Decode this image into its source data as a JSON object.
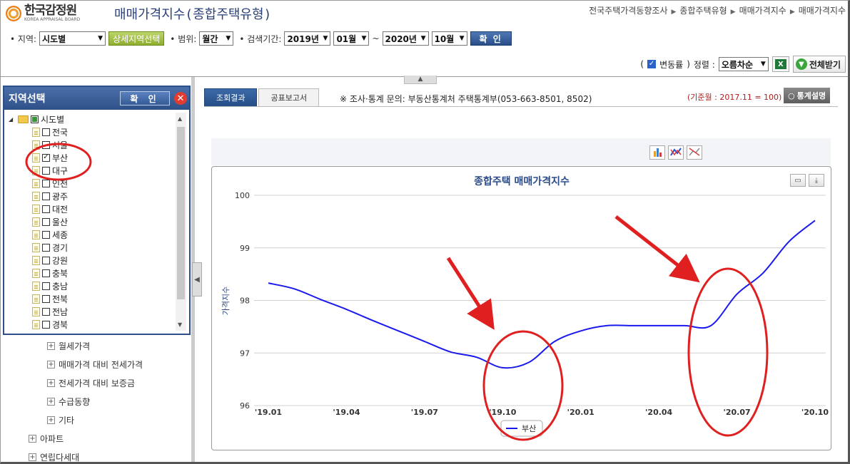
{
  "header": {
    "logo_name": "한국감정원",
    "logo_sub": "KOREA APPRAISAL BOARD",
    "title": "매매가격지수(종합주택유형)",
    "breadcrumb": [
      "전국주택가격동향조사",
      "종합주택유형",
      "매매가격지수",
      "매매가격지수"
    ]
  },
  "search": {
    "region_label": "지역:",
    "region_value": "시도별",
    "detail_button": "상세지역선택",
    "range_label": "범위:",
    "range_value": "월간",
    "period_label": "검색기간:",
    "from_year": "2019년",
    "from_month": "01월",
    "tilde": "~",
    "to_year": "2020년",
    "to_month": "10월",
    "confirm": "확 인"
  },
  "options": {
    "change_rate_label": "변동률",
    "paren_open": "(",
    "paren_close": ")",
    "sort_label": "정렬 :",
    "sort_value": "오름차순",
    "download_all": "전체받기"
  },
  "region_panel": {
    "title": "지역선택",
    "confirm": "확 인",
    "root": "시도별",
    "items": [
      {
        "label": "전국",
        "checked": false
      },
      {
        "label": "서울",
        "checked": false
      },
      {
        "label": "부산",
        "checked": true
      },
      {
        "label": "대구",
        "checked": false
      },
      {
        "label": "인천",
        "checked": false
      },
      {
        "label": "광주",
        "checked": false
      },
      {
        "label": "대전",
        "checked": false
      },
      {
        "label": "울산",
        "checked": false
      },
      {
        "label": "세종",
        "checked": false
      },
      {
        "label": "경기",
        "checked": false
      },
      {
        "label": "강원",
        "checked": false
      },
      {
        "label": "충북",
        "checked": false
      },
      {
        "label": "충남",
        "checked": false
      },
      {
        "label": "전북",
        "checked": false
      },
      {
        "label": "전남",
        "checked": false
      },
      {
        "label": "경북",
        "checked": false
      }
    ]
  },
  "menu": {
    "sub_items": [
      "월세가격",
      "매매가격 대비 전세가격",
      "전세가격 대비 보증금",
      "수급동향",
      "기타"
    ],
    "top_items": [
      "아파트",
      "연립다세대"
    ]
  },
  "content": {
    "tab_result": "조회결과",
    "tab_report": "공표보고서",
    "inquiry": "※ 조사·통계 문의: 부동산통계처 주택통계부(053-663-8501, 8502)",
    "base_month": "(기준월 : 2017.11 = 100)",
    "stat_button": "통계설명"
  },
  "chart_data": {
    "type": "line",
    "title": "종합주택 매매가격지수",
    "ylabel": "가격지수",
    "xlabel": "",
    "ylim": [
      96,
      100
    ],
    "yticks": [
      96,
      97,
      98,
      99,
      100
    ],
    "categories": [
      "'19.01",
      "'19.02",
      "'19.03",
      "'19.04",
      "'19.05",
      "'19.06",
      "'19.07",
      "'19.08",
      "'19.09",
      "'19.10",
      "'19.11",
      "'19.12",
      "'20.01",
      "'20.02",
      "'20.03",
      "'20.04",
      "'20.05",
      "'20.06",
      "'20.07",
      "'20.08",
      "'20.09",
      "'20.10"
    ],
    "tick_labels": [
      "'19.01",
      "'19.04",
      "'19.07",
      "'19.10",
      "'20.01",
      "'20.04",
      "'20.07",
      "'20.10"
    ],
    "series": [
      {
        "name": "부산",
        "color": "#1a1aee",
        "values": [
          98.33,
          98.22,
          98.02,
          97.83,
          97.62,
          97.42,
          97.22,
          97.02,
          96.92,
          96.72,
          96.82,
          97.22,
          97.42,
          97.52,
          97.52,
          97.52,
          97.52,
          97.52,
          98.12,
          98.52,
          99.12,
          99.52
        ]
      }
    ],
    "legend": "bottom-center",
    "grid": true
  }
}
